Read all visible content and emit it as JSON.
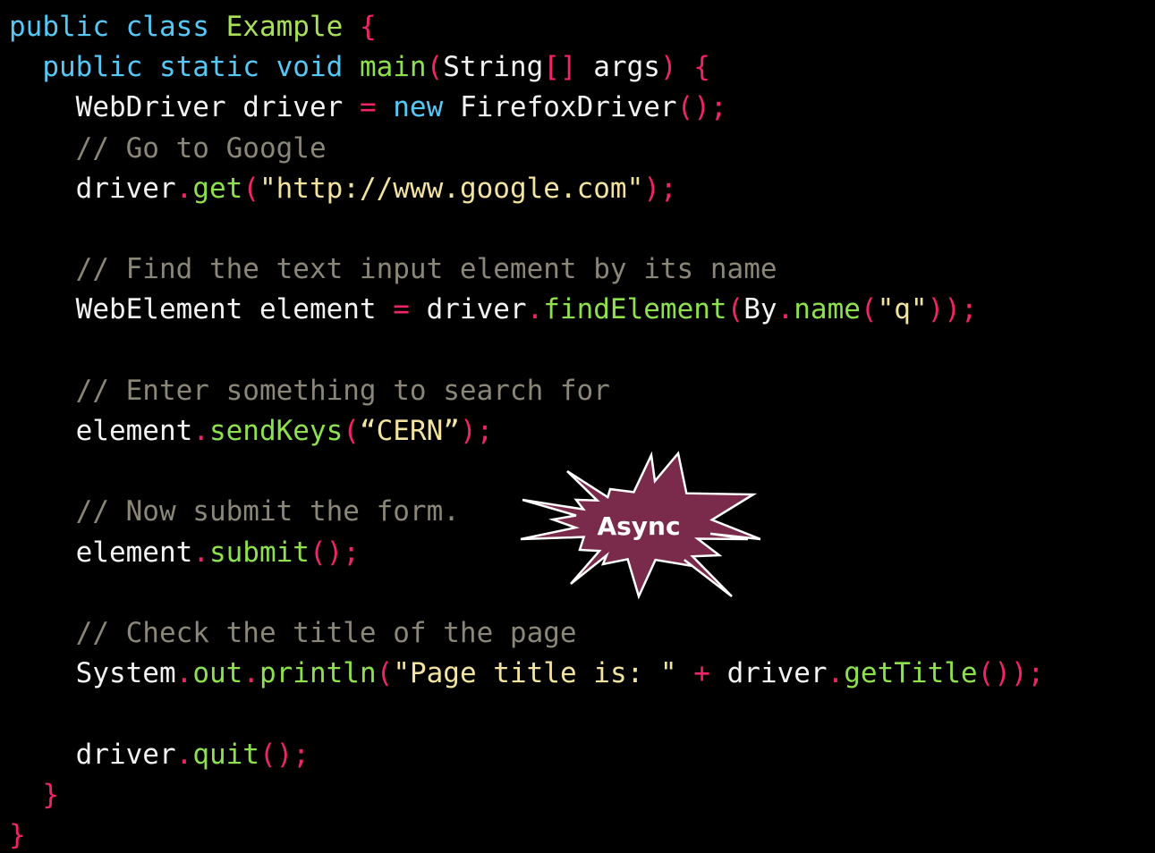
{
  "code": {
    "lines": [
      [
        {
          "t": "public class ",
          "c": "kw"
        },
        {
          "t": "Example",
          "c": "cls"
        },
        {
          "t": " {",
          "c": "punc"
        }
      ],
      [
        {
          "t": "  public static void ",
          "c": "kw"
        },
        {
          "t": "main",
          "c": "fn"
        },
        {
          "t": "(",
          "c": "punc"
        },
        {
          "t": "String",
          "c": "plain"
        },
        {
          "t": "[]",
          "c": "punc"
        },
        {
          "t": " args",
          "c": "plain"
        },
        {
          "t": ") {",
          "c": "punc"
        }
      ],
      [
        {
          "t": "    WebDriver driver ",
          "c": "plain"
        },
        {
          "t": "=",
          "c": "punc"
        },
        {
          "t": " new ",
          "c": "kw"
        },
        {
          "t": "FirefoxDriver",
          "c": "plain"
        },
        {
          "t": "();",
          "c": "punc"
        }
      ],
      [
        {
          "t": "    // Go to Google",
          "c": "cmt"
        }
      ],
      [
        {
          "t": "    driver",
          "c": "plain"
        },
        {
          "t": ".",
          "c": "punc"
        },
        {
          "t": "get",
          "c": "fn"
        },
        {
          "t": "(",
          "c": "punc"
        },
        {
          "t": "\"http://www.google.com\"",
          "c": "str"
        },
        {
          "t": ");",
          "c": "punc"
        }
      ],
      [],
      [
        {
          "t": "    // Find the text input element by its name",
          "c": "cmt"
        }
      ],
      [
        {
          "t": "    WebElement element ",
          "c": "plain"
        },
        {
          "t": "=",
          "c": "punc"
        },
        {
          "t": " driver",
          "c": "plain"
        },
        {
          "t": ".",
          "c": "punc"
        },
        {
          "t": "findElement",
          "c": "fn"
        },
        {
          "t": "(",
          "c": "punc"
        },
        {
          "t": "By",
          "c": "plain"
        },
        {
          "t": ".",
          "c": "punc"
        },
        {
          "t": "name",
          "c": "fn"
        },
        {
          "t": "(",
          "c": "punc"
        },
        {
          "t": "\"q\"",
          "c": "str"
        },
        {
          "t": "));",
          "c": "punc"
        }
      ],
      [],
      [
        {
          "t": "    // Enter something to search for",
          "c": "cmt"
        }
      ],
      [
        {
          "t": "    element",
          "c": "plain"
        },
        {
          "t": ".",
          "c": "punc"
        },
        {
          "t": "sendKeys",
          "c": "fn"
        },
        {
          "t": "(",
          "c": "punc"
        },
        {
          "t": "“CERN”",
          "c": "str"
        },
        {
          "t": ");",
          "c": "punc"
        }
      ],
      [],
      [
        {
          "t": "    // Now submit the form.",
          "c": "cmt"
        }
      ],
      [
        {
          "t": "    element",
          "c": "plain"
        },
        {
          "t": ".",
          "c": "punc"
        },
        {
          "t": "submit",
          "c": "fn"
        },
        {
          "t": "();",
          "c": "punc"
        }
      ],
      [],
      [
        {
          "t": "    // Check the title of the page",
          "c": "cmt"
        }
      ],
      [
        {
          "t": "    System",
          "c": "plain"
        },
        {
          "t": ".",
          "c": "punc"
        },
        {
          "t": "out",
          "c": "fn"
        },
        {
          "t": ".",
          "c": "punc"
        },
        {
          "t": "println",
          "c": "fn"
        },
        {
          "t": "(",
          "c": "punc"
        },
        {
          "t": "\"Page title is: \"",
          "c": "str"
        },
        {
          "t": " + ",
          "c": "punc"
        },
        {
          "t": "driver",
          "c": "plain"
        },
        {
          "t": ".",
          "c": "punc"
        },
        {
          "t": "getTitle",
          "c": "fn"
        },
        {
          "t": "());",
          "c": "punc"
        }
      ],
      [],
      [
        {
          "t": "    driver",
          "c": "plain"
        },
        {
          "t": ".",
          "c": "punc"
        },
        {
          "t": "quit",
          "c": "fn"
        },
        {
          "t": "();",
          "c": "punc"
        }
      ],
      [
        {
          "t": "  }",
          "c": "punc"
        }
      ],
      [
        {
          "t": "}",
          "c": "punc"
        }
      ]
    ]
  },
  "callout": {
    "label": "Async",
    "fill_color": "#7a2a4a",
    "stroke_color": "#ffffff"
  },
  "colors": {
    "background": "#000000",
    "keyword": "#56c8f5",
    "class_name": "#a9e05a",
    "punctuation": "#f0246b",
    "method": "#8ee04e",
    "string": "#f2e3a0",
    "comment": "#8a8678",
    "plain": "#f2f2f2"
  }
}
